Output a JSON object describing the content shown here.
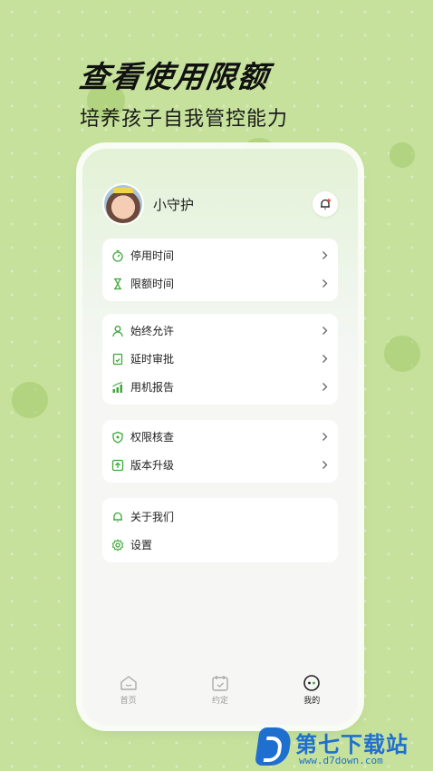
{
  "promo": {
    "headline": "查看使用限额",
    "subline": "培养孩子自我管控能力"
  },
  "profile": {
    "name": "小守护",
    "bell_icon": "bell-icon"
  },
  "menu_groups": [
    [
      {
        "label": "停用时间",
        "icon": "stopwatch-icon"
      },
      {
        "label": "限额时间",
        "icon": "hourglass-icon"
      }
    ],
    [
      {
        "label": "始终允许",
        "icon": "person-icon"
      },
      {
        "label": "延时审批",
        "icon": "document-check-icon"
      },
      {
        "label": "用机报告",
        "icon": "bar-chart-icon"
      }
    ],
    [
      {
        "label": "权限核查",
        "icon": "shield-icon"
      },
      {
        "label": "版本升级",
        "icon": "upgrade-icon"
      }
    ],
    [
      {
        "label": "关于我们",
        "icon": "bell-icon"
      },
      {
        "label": "设置",
        "icon": "gear-icon"
      }
    ]
  ],
  "tabs": [
    {
      "label": "首页",
      "icon": "home-icon",
      "active": false
    },
    {
      "label": "约定",
      "icon": "calendar-icon",
      "active": false
    },
    {
      "label": "我的",
      "icon": "profile-face-icon",
      "active": true
    }
  ],
  "watermark": {
    "title": "第七下载站",
    "url": "www.d7down.com"
  },
  "colors": {
    "background": "#c5e19b",
    "accent": "#3fa83c",
    "brand_watermark": "#1f6fd1"
  }
}
